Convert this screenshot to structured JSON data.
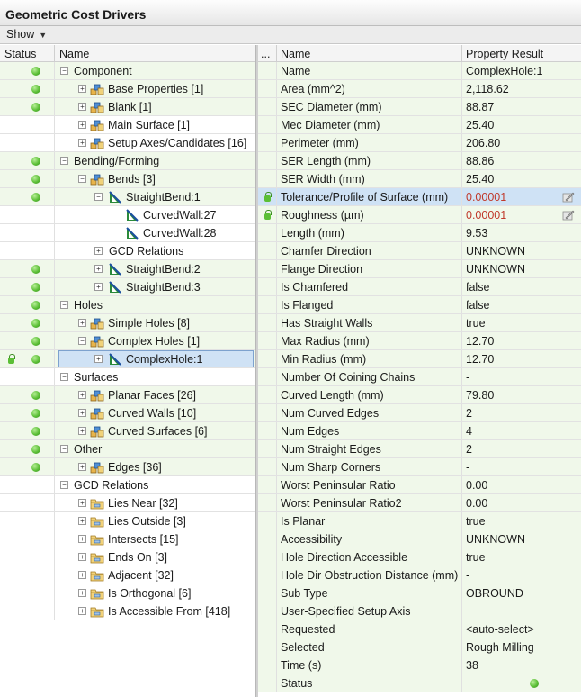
{
  "window": {
    "title": "Geometric Cost Drivers"
  },
  "toolbar": {
    "show_label": "Show"
  },
  "tree": {
    "columns": {
      "status": "Status",
      "name": "Name"
    },
    "rows": [
      {
        "level": 0,
        "label": "Component",
        "status": true,
        "icon": "none",
        "expander": "-"
      },
      {
        "level": 1,
        "label": "Base Properties [1]",
        "status": true,
        "icon": "feature",
        "expander": "+"
      },
      {
        "level": 1,
        "label": "Blank [1]",
        "status": true,
        "icon": "feature",
        "expander": "+"
      },
      {
        "level": 1,
        "label": "Main Surface [1]",
        "status": false,
        "icon": "feature",
        "expander": "+"
      },
      {
        "level": 1,
        "label": "Setup Axes/Candidates [16]",
        "status": false,
        "icon": "feature",
        "expander": "+"
      },
      {
        "level": 0,
        "label": "Bending/Forming",
        "status": true,
        "icon": "none",
        "expander": "-"
      },
      {
        "level": 1,
        "label": "Bends [3]",
        "status": true,
        "icon": "feature",
        "expander": "-"
      },
      {
        "level": 2,
        "label": "StraightBend:1",
        "status": true,
        "icon": "bend",
        "expander": "-"
      },
      {
        "level": 3,
        "label": "CurvedWall:27",
        "status": false,
        "icon": "bend",
        "expander": ""
      },
      {
        "level": 3,
        "label": "CurvedWall:28",
        "status": false,
        "icon": "bend",
        "expander": ""
      },
      {
        "level": 2,
        "label": "GCD Relations",
        "status": false,
        "icon": "none",
        "expander": "+"
      },
      {
        "level": 2,
        "label": "StraightBend:2",
        "status": true,
        "icon": "bend",
        "expander": "+"
      },
      {
        "level": 2,
        "label": "StraightBend:3",
        "status": true,
        "icon": "bend",
        "expander": "+"
      },
      {
        "level": 0,
        "label": "Holes",
        "status": true,
        "icon": "none",
        "expander": "-"
      },
      {
        "level": 1,
        "label": "Simple Holes [8]",
        "status": true,
        "icon": "feature",
        "expander": "+"
      },
      {
        "level": 1,
        "label": "Complex Holes [1]",
        "status": true,
        "icon": "feature",
        "expander": "-"
      },
      {
        "level": 2,
        "label": "ComplexHole:1",
        "status": true,
        "icon": "bend",
        "expander": "+",
        "selected": true,
        "locked": true
      },
      {
        "level": 0,
        "label": "Surfaces",
        "status": false,
        "icon": "none",
        "expander": "-"
      },
      {
        "level": 1,
        "label": "Planar Faces [26]",
        "status": true,
        "icon": "feature",
        "expander": "+"
      },
      {
        "level": 1,
        "label": "Curved Walls [10]",
        "status": true,
        "icon": "feature",
        "expander": "+"
      },
      {
        "level": 1,
        "label": "Curved Surfaces [6]",
        "status": true,
        "icon": "feature",
        "expander": "+"
      },
      {
        "level": 0,
        "label": "Other",
        "status": true,
        "icon": "none",
        "expander": "-"
      },
      {
        "level": 1,
        "label": "Edges [36]",
        "status": true,
        "icon": "feature",
        "expander": "+"
      },
      {
        "level": 0,
        "label": "GCD Relations",
        "status": false,
        "icon": "none",
        "expander": "-"
      },
      {
        "level": 1,
        "label": "Lies Near [32]",
        "status": false,
        "icon": "folder",
        "expander": "+"
      },
      {
        "level": 1,
        "label": "Lies Outside [3]",
        "status": false,
        "icon": "folder",
        "expander": "+"
      },
      {
        "level": 1,
        "label": "Intersects [15]",
        "status": false,
        "icon": "folder",
        "expander": "+"
      },
      {
        "level": 1,
        "label": "Ends On [3]",
        "status": false,
        "icon": "folder",
        "expander": "+"
      },
      {
        "level": 1,
        "label": "Adjacent [32]",
        "status": false,
        "icon": "folder",
        "expander": "+"
      },
      {
        "level": 1,
        "label": "Is Orthogonal [6]",
        "status": false,
        "icon": "folder",
        "expander": "+"
      },
      {
        "level": 1,
        "label": "Is Accessible From [418]",
        "status": false,
        "icon": "folder",
        "expander": "+"
      }
    ]
  },
  "properties": {
    "columns": {
      "lock": "...",
      "name": "Name",
      "result": "Property Result"
    },
    "rows": [
      {
        "name": "Name",
        "value": "ComplexHole:1"
      },
      {
        "name": "Area (mm^2)",
        "value": "2,118.62"
      },
      {
        "name": "SEC Diameter (mm)",
        "value": "88.87"
      },
      {
        "name": "Mec Diameter (mm)",
        "value": "25.40"
      },
      {
        "name": "Perimeter (mm)",
        "value": "206.80"
      },
      {
        "name": "SER Length (mm)",
        "value": "88.86"
      },
      {
        "name": "SER Width (mm)",
        "value": "25.40"
      },
      {
        "name": "Tolerance/Profile of Surface (mm)",
        "value": "0.00001",
        "locked": true,
        "red": true,
        "editable": true,
        "selected": true
      },
      {
        "name": "Roughness (µm)",
        "value": "0.00001",
        "locked": true,
        "red": true,
        "editable": true
      },
      {
        "name": "Length (mm)",
        "value": "9.53"
      },
      {
        "name": "Chamfer Direction",
        "value": "UNKNOWN"
      },
      {
        "name": "Flange Direction",
        "value": "UNKNOWN"
      },
      {
        "name": "Is Chamfered",
        "value": "false"
      },
      {
        "name": "Is Flanged",
        "value": "false"
      },
      {
        "name": "Has Straight Walls",
        "value": "true"
      },
      {
        "name": "Max Radius (mm)",
        "value": "12.70"
      },
      {
        "name": "Min Radius (mm)",
        "value": "12.70"
      },
      {
        "name": "Number Of Coining Chains",
        "value": "-"
      },
      {
        "name": "Curved Length (mm)",
        "value": "79.80"
      },
      {
        "name": "Num Curved Edges",
        "value": "2"
      },
      {
        "name": "Num Edges",
        "value": "4"
      },
      {
        "name": "Num Straight Edges",
        "value": "2"
      },
      {
        "name": "Num Sharp Corners",
        "value": "-"
      },
      {
        "name": "Worst Peninsular Ratio",
        "value": "0.00"
      },
      {
        "name": "Worst Peninsular Ratio2",
        "value": "0.00"
      },
      {
        "name": "Is Planar",
        "value": "true"
      },
      {
        "name": "Accessibility",
        "value": "UNKNOWN"
      },
      {
        "name": "Hole Direction Accessible",
        "value": "true"
      },
      {
        "name": "Hole Dir Obstruction Distance (mm)",
        "value": "-"
      },
      {
        "name": "Sub Type",
        "value": "OBROUND"
      },
      {
        "name": "User-Specified Setup Axis",
        "value": ""
      },
      {
        "name": "Requested",
        "value": "<auto-select>"
      },
      {
        "name": "Selected",
        "value": "Rough Milling"
      },
      {
        "name": "Time (s)",
        "value": "38"
      },
      {
        "name": "Status",
        "value": "",
        "status_dot": true
      }
    ]
  }
}
